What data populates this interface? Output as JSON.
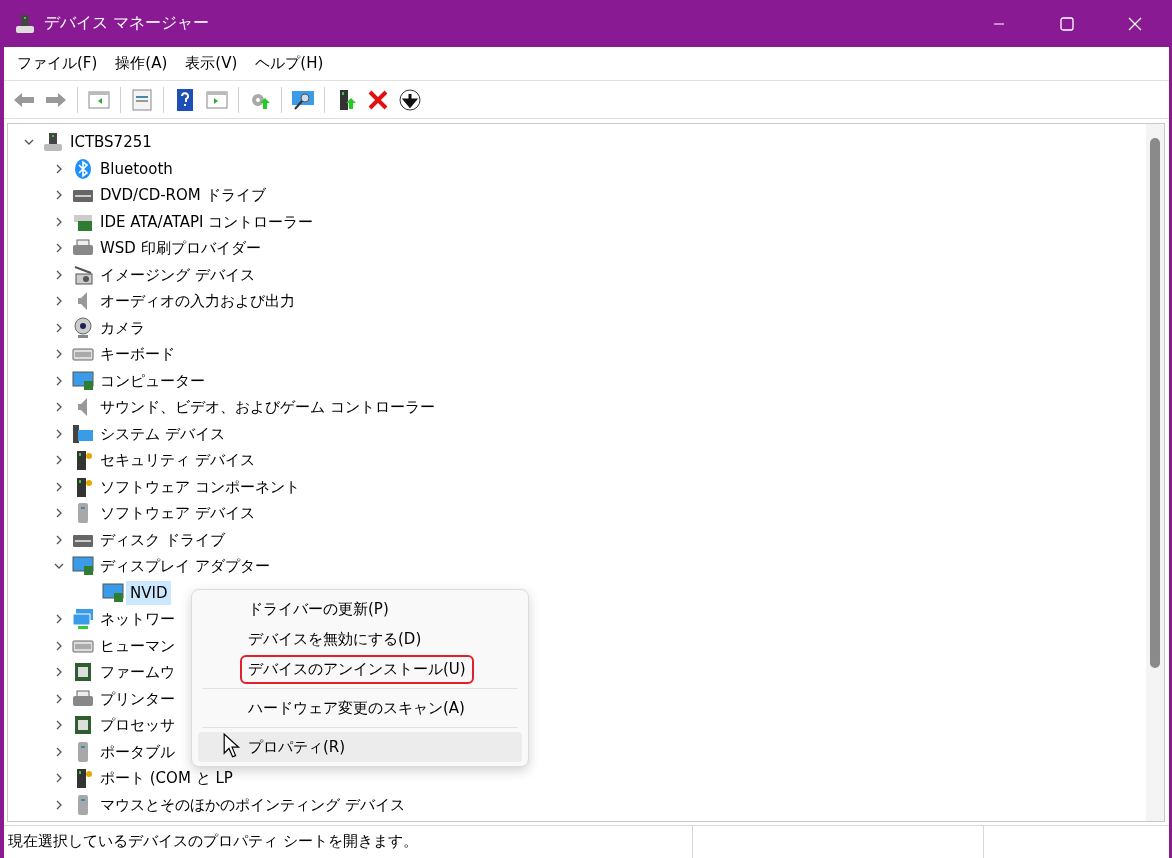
{
  "window": {
    "title": "デバイス マネージャー"
  },
  "menu_bar": [
    "ファイル(F)",
    "操作(A)",
    "表示(V)",
    "ヘルプ(H)"
  ],
  "tree": {
    "label": "ICTBS7251",
    "kind": "computer",
    "expanded": true,
    "selected": false,
    "children": [
      {
        "label": "Bluetooth",
        "kind": "bluetooth",
        "expanded": false,
        "selected": false
      },
      {
        "label": "DVD/CD-ROM ドライブ",
        "kind": "drive",
        "expanded": false,
        "selected": false
      },
      {
        "label": "IDE ATA/ATAPI コントローラー",
        "kind": "board",
        "expanded": false,
        "selected": false
      },
      {
        "label": "WSD 印刷プロバイダー",
        "kind": "printer",
        "expanded": false,
        "selected": false
      },
      {
        "label": "イメージング デバイス",
        "kind": "camera",
        "expanded": false,
        "selected": false
      },
      {
        "label": "オーディオの入力および出力",
        "kind": "speaker",
        "expanded": false,
        "selected": false
      },
      {
        "label": "カメラ",
        "kind": "webcam",
        "expanded": false,
        "selected": false
      },
      {
        "label": "キーボード",
        "kind": "keyboard",
        "expanded": false,
        "selected": false
      },
      {
        "label": "コンピューター",
        "kind": "monitor",
        "expanded": false,
        "selected": false
      },
      {
        "label": "サウンド、ビデオ、およびゲーム コントローラー",
        "kind": "speaker",
        "expanded": false,
        "selected": false
      },
      {
        "label": "システム デバイス",
        "kind": "system",
        "expanded": false,
        "selected": false
      },
      {
        "label": "セキュリティ デバイス",
        "kind": "tower",
        "expanded": false,
        "selected": false
      },
      {
        "label": "ソフトウェア コンポーネント",
        "kind": "tower",
        "expanded": false,
        "selected": false
      },
      {
        "label": "ソフトウェア デバイス",
        "kind": "case",
        "expanded": false,
        "selected": false
      },
      {
        "label": "ディスク ドライブ",
        "kind": "drive",
        "expanded": false,
        "selected": false
      },
      {
        "label": "ディスプレイ アダプター",
        "kind": "monitor",
        "expanded": true,
        "selected": false,
        "children": [
          {
            "label": "NVID",
            "kind": "monitor",
            "selected": true
          }
        ]
      },
      {
        "label": "ネットワー",
        "kind": "network",
        "expanded": false,
        "selected": false
      },
      {
        "label": "ヒューマン",
        "kind": "keyboard",
        "expanded": false,
        "selected": false
      },
      {
        "label": "ファームウ",
        "kind": "chip",
        "expanded": false,
        "selected": false
      },
      {
        "label": "プリンター",
        "kind": "printer",
        "expanded": false,
        "selected": false
      },
      {
        "label": "プロセッサ",
        "kind": "chip",
        "expanded": false,
        "selected": false
      },
      {
        "label": "ポータブル",
        "kind": "case",
        "expanded": false,
        "selected": false
      },
      {
        "label": "ポート (COM と LP",
        "kind": "tower",
        "expanded": false,
        "selected": false
      },
      {
        "label": "マウスとそのほかのポインティング デバイス",
        "kind": "case",
        "expanded": false,
        "selected": false
      }
    ]
  },
  "context_menu": [
    {
      "kind": "item",
      "label": "ドライバーの更新(P)",
      "selected": false,
      "highlighted": false
    },
    {
      "kind": "item",
      "label": "デバイスを無効にする(D)",
      "selected": false,
      "highlighted": false
    },
    {
      "kind": "item",
      "label": "デバイスのアンインストール(U)",
      "selected": false,
      "highlighted": true
    },
    {
      "kind": "separator"
    },
    {
      "kind": "item",
      "label": "ハードウェア変更のスキャン(A)",
      "selected": false,
      "highlighted": false
    },
    {
      "kind": "separator"
    },
    {
      "kind": "item",
      "label": "プロパティ(R)",
      "selected": true,
      "highlighted": false
    }
  ],
  "status_bar": "現在選択しているデバイスのプロパティ シートを開きます。"
}
